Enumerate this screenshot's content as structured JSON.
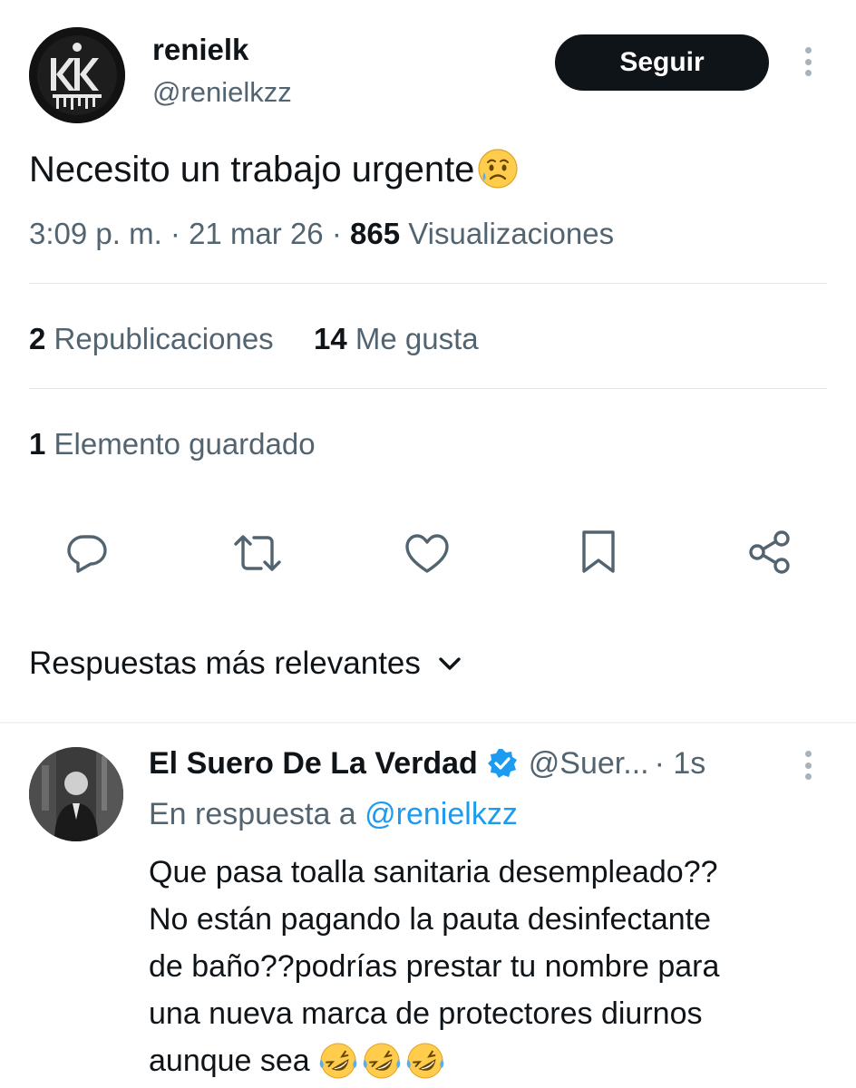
{
  "tweet": {
    "author_name": "renielk",
    "author_handle": "@renielkzz",
    "avatar_label": "KK",
    "follow_label": "Seguir",
    "text": "Necesito un trabajo urgente",
    "emoji": "sad-but-relieved-face",
    "time": "3:09 p. m. · 21 mar 26 · ",
    "views_count": "865",
    "views_label": " Visualizaciones",
    "reposts_count": "2",
    "reposts_label": " Republicaciones",
    "likes_count": "14",
    "likes_label": " Me gusta",
    "bookmarks_count": "1",
    "bookmarks_label": " Elemento guardado"
  },
  "actions": [
    "reply-icon",
    "repost-icon",
    "like-icon",
    "bookmark-icon",
    "share-icon"
  ],
  "replies_header": {
    "label": "Respuestas más relevantes"
  },
  "reply": {
    "author_name": "El Suero De La Verdad",
    "author_handle": "@Suer...",
    "time": " · 1s",
    "in_reply_prefix": "En respuesta a ",
    "in_reply_handle": "@renielkzz",
    "lines": [
      "Que pasa toalla sanitaria desempleado??",
      "No están pagando la pauta desinfectante",
      "de baño??podrías prestar tu nombre para",
      "una nueva marca de protectores diurnos",
      "aunque sea "
    ],
    "trailing_emoji": [
      "rolling-on-floor-laughing",
      "rolling-on-floor-laughing",
      "rolling-on-floor-laughing"
    ]
  },
  "colors": {
    "text": "#0f1419",
    "secondary": "#536471",
    "link": "#1d9bf0",
    "verified": "#1d9bf0",
    "follow_bg": "#0f1419"
  }
}
